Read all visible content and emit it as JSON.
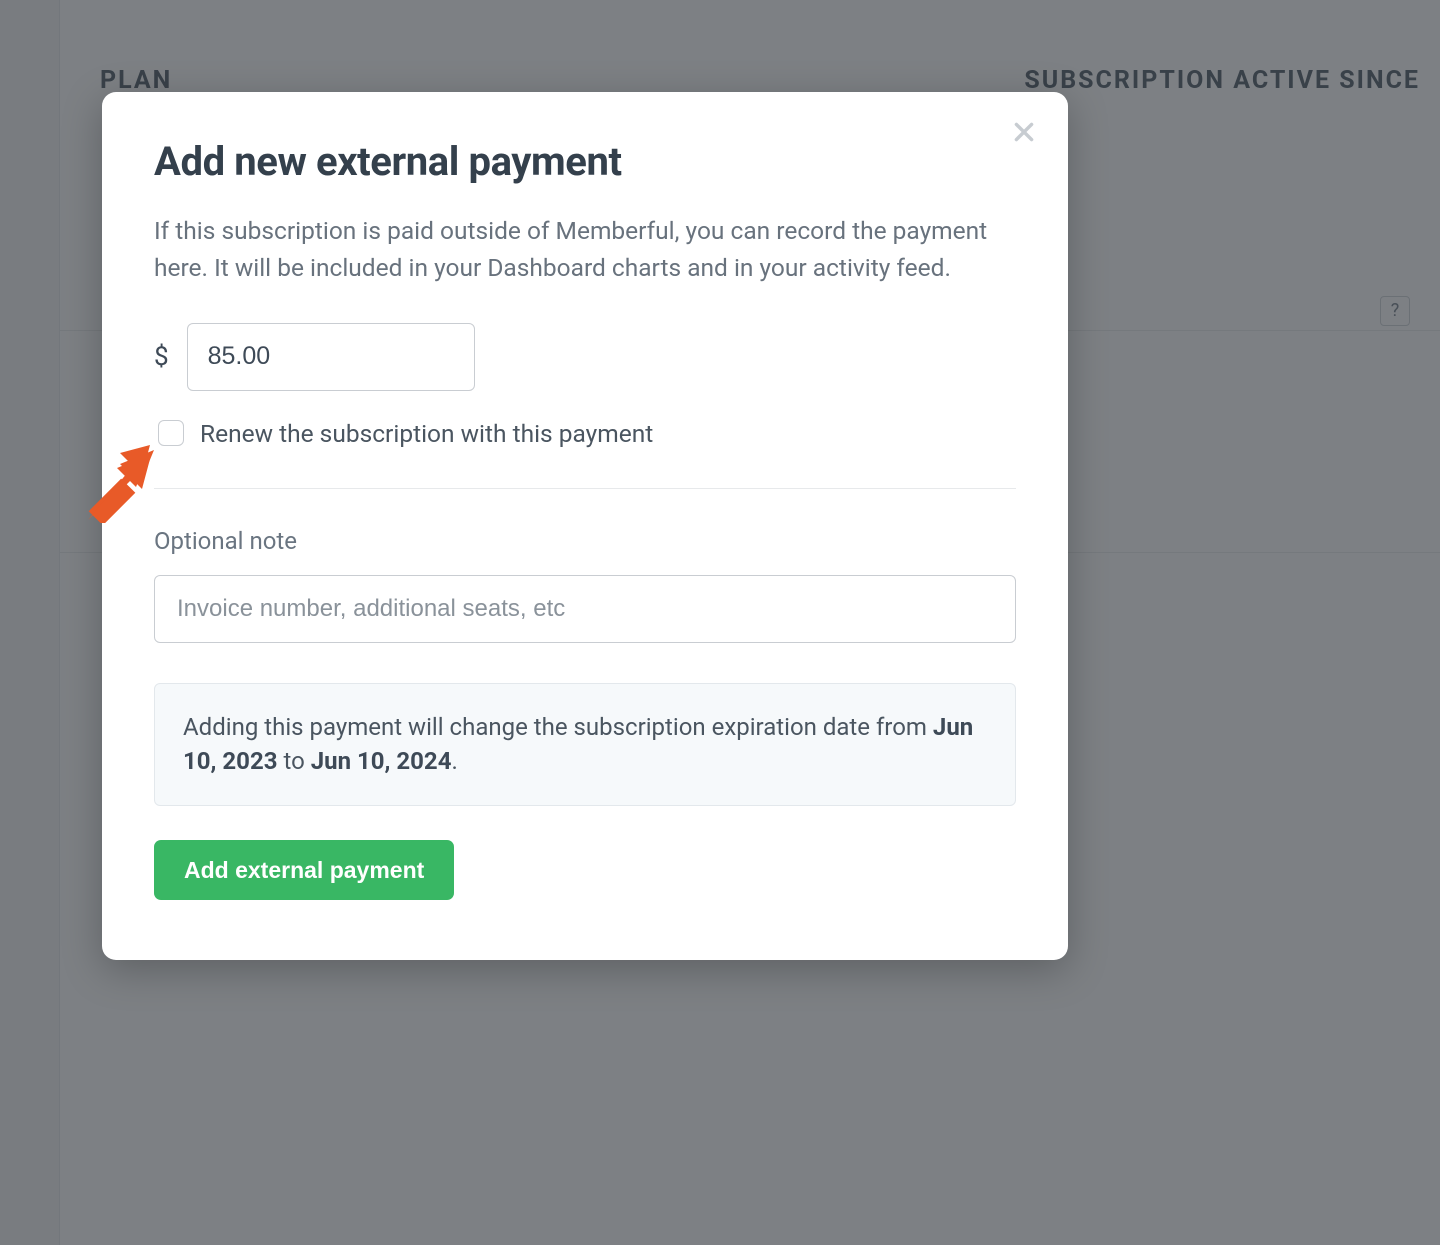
{
  "background": {
    "header_left": "PLAN",
    "header_right": "SUBSCRIPTION ACTIVE SINCE",
    "help_symbol": "?"
  },
  "modal": {
    "title": "Add new external payment",
    "description": "If this subscription is paid outside of Memberful, you can record the payment here. It will be included in your Dashboard charts and in your activity feed.",
    "currency_symbol": "$",
    "amount_value": "85.00",
    "renew_checkbox_label": "Renew the subscription with this payment",
    "note_label": "Optional note",
    "note_placeholder": "Invoice number, additional seats, etc",
    "info": {
      "prefix": "Adding this payment will change the subscription expiration date from ",
      "from_date": "Jun 10, 2023",
      "middle": " to ",
      "to_date": "Jun 10, 2024",
      "suffix": "."
    },
    "submit_label": "Add external payment"
  }
}
